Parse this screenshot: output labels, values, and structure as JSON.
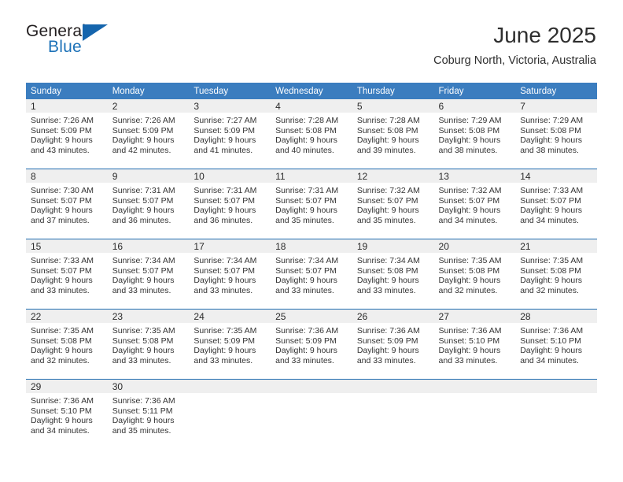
{
  "brand": {
    "word1": "General",
    "word2": "Blue",
    "triangle_color": "#1565ad"
  },
  "header": {
    "title": "June 2025",
    "subtitle": "Coburg North, Victoria, Australia"
  },
  "theme": {
    "header_blue": "#3b7dbf",
    "rule_blue": "#1f6cb0",
    "daynum_band": "#efefef"
  },
  "weekday_headers": [
    "Sunday",
    "Monday",
    "Tuesday",
    "Wednesday",
    "Thursday",
    "Friday",
    "Saturday"
  ],
  "labels": {
    "sunrise_prefix": "Sunrise:",
    "sunset_prefix": "Sunset:",
    "daylight_prefix": "Daylight:"
  },
  "weeks": [
    [
      {
        "day": "1",
        "sunrise": "Sunrise: 7:26 AM",
        "sunset": "Sunset: 5:09 PM",
        "daylight_l1": "Daylight: 9 hours",
        "daylight_l2": "and 43 minutes."
      },
      {
        "day": "2",
        "sunrise": "Sunrise: 7:26 AM",
        "sunset": "Sunset: 5:09 PM",
        "daylight_l1": "Daylight: 9 hours",
        "daylight_l2": "and 42 minutes."
      },
      {
        "day": "3",
        "sunrise": "Sunrise: 7:27 AM",
        "sunset": "Sunset: 5:09 PM",
        "daylight_l1": "Daylight: 9 hours",
        "daylight_l2": "and 41 minutes."
      },
      {
        "day": "4",
        "sunrise": "Sunrise: 7:28 AM",
        "sunset": "Sunset: 5:08 PM",
        "daylight_l1": "Daylight: 9 hours",
        "daylight_l2": "and 40 minutes."
      },
      {
        "day": "5",
        "sunrise": "Sunrise: 7:28 AM",
        "sunset": "Sunset: 5:08 PM",
        "daylight_l1": "Daylight: 9 hours",
        "daylight_l2": "and 39 minutes."
      },
      {
        "day": "6",
        "sunrise": "Sunrise: 7:29 AM",
        "sunset": "Sunset: 5:08 PM",
        "daylight_l1": "Daylight: 9 hours",
        "daylight_l2": "and 38 minutes."
      },
      {
        "day": "7",
        "sunrise": "Sunrise: 7:29 AM",
        "sunset": "Sunset: 5:08 PM",
        "daylight_l1": "Daylight: 9 hours",
        "daylight_l2": "and 38 minutes."
      }
    ],
    [
      {
        "day": "8",
        "sunrise": "Sunrise: 7:30 AM",
        "sunset": "Sunset: 5:07 PM",
        "daylight_l1": "Daylight: 9 hours",
        "daylight_l2": "and 37 minutes."
      },
      {
        "day": "9",
        "sunrise": "Sunrise: 7:31 AM",
        "sunset": "Sunset: 5:07 PM",
        "daylight_l1": "Daylight: 9 hours",
        "daylight_l2": "and 36 minutes."
      },
      {
        "day": "10",
        "sunrise": "Sunrise: 7:31 AM",
        "sunset": "Sunset: 5:07 PM",
        "daylight_l1": "Daylight: 9 hours",
        "daylight_l2": "and 36 minutes."
      },
      {
        "day": "11",
        "sunrise": "Sunrise: 7:31 AM",
        "sunset": "Sunset: 5:07 PM",
        "daylight_l1": "Daylight: 9 hours",
        "daylight_l2": "and 35 minutes."
      },
      {
        "day": "12",
        "sunrise": "Sunrise: 7:32 AM",
        "sunset": "Sunset: 5:07 PM",
        "daylight_l1": "Daylight: 9 hours",
        "daylight_l2": "and 35 minutes."
      },
      {
        "day": "13",
        "sunrise": "Sunrise: 7:32 AM",
        "sunset": "Sunset: 5:07 PM",
        "daylight_l1": "Daylight: 9 hours",
        "daylight_l2": "and 34 minutes."
      },
      {
        "day": "14",
        "sunrise": "Sunrise: 7:33 AM",
        "sunset": "Sunset: 5:07 PM",
        "daylight_l1": "Daylight: 9 hours",
        "daylight_l2": "and 34 minutes."
      }
    ],
    [
      {
        "day": "15",
        "sunrise": "Sunrise: 7:33 AM",
        "sunset": "Sunset: 5:07 PM",
        "daylight_l1": "Daylight: 9 hours",
        "daylight_l2": "and 33 minutes."
      },
      {
        "day": "16",
        "sunrise": "Sunrise: 7:34 AM",
        "sunset": "Sunset: 5:07 PM",
        "daylight_l1": "Daylight: 9 hours",
        "daylight_l2": "and 33 minutes."
      },
      {
        "day": "17",
        "sunrise": "Sunrise: 7:34 AM",
        "sunset": "Sunset: 5:07 PM",
        "daylight_l1": "Daylight: 9 hours",
        "daylight_l2": "and 33 minutes."
      },
      {
        "day": "18",
        "sunrise": "Sunrise: 7:34 AM",
        "sunset": "Sunset: 5:07 PM",
        "daylight_l1": "Daylight: 9 hours",
        "daylight_l2": "and 33 minutes."
      },
      {
        "day": "19",
        "sunrise": "Sunrise: 7:34 AM",
        "sunset": "Sunset: 5:08 PM",
        "daylight_l1": "Daylight: 9 hours",
        "daylight_l2": "and 33 minutes."
      },
      {
        "day": "20",
        "sunrise": "Sunrise: 7:35 AM",
        "sunset": "Sunset: 5:08 PM",
        "daylight_l1": "Daylight: 9 hours",
        "daylight_l2": "and 32 minutes."
      },
      {
        "day": "21",
        "sunrise": "Sunrise: 7:35 AM",
        "sunset": "Sunset: 5:08 PM",
        "daylight_l1": "Daylight: 9 hours",
        "daylight_l2": "and 32 minutes."
      }
    ],
    [
      {
        "day": "22",
        "sunrise": "Sunrise: 7:35 AM",
        "sunset": "Sunset: 5:08 PM",
        "daylight_l1": "Daylight: 9 hours",
        "daylight_l2": "and 32 minutes."
      },
      {
        "day": "23",
        "sunrise": "Sunrise: 7:35 AM",
        "sunset": "Sunset: 5:08 PM",
        "daylight_l1": "Daylight: 9 hours",
        "daylight_l2": "and 33 minutes."
      },
      {
        "day": "24",
        "sunrise": "Sunrise: 7:35 AM",
        "sunset": "Sunset: 5:09 PM",
        "daylight_l1": "Daylight: 9 hours",
        "daylight_l2": "and 33 minutes."
      },
      {
        "day": "25",
        "sunrise": "Sunrise: 7:36 AM",
        "sunset": "Sunset: 5:09 PM",
        "daylight_l1": "Daylight: 9 hours",
        "daylight_l2": "and 33 minutes."
      },
      {
        "day": "26",
        "sunrise": "Sunrise: 7:36 AM",
        "sunset": "Sunset: 5:09 PM",
        "daylight_l1": "Daylight: 9 hours",
        "daylight_l2": "and 33 minutes."
      },
      {
        "day": "27",
        "sunrise": "Sunrise: 7:36 AM",
        "sunset": "Sunset: 5:10 PM",
        "daylight_l1": "Daylight: 9 hours",
        "daylight_l2": "and 33 minutes."
      },
      {
        "day": "28",
        "sunrise": "Sunrise: 7:36 AM",
        "sunset": "Sunset: 5:10 PM",
        "daylight_l1": "Daylight: 9 hours",
        "daylight_l2": "and 34 minutes."
      }
    ],
    [
      {
        "day": "29",
        "sunrise": "Sunrise: 7:36 AM",
        "sunset": "Sunset: 5:10 PM",
        "daylight_l1": "Daylight: 9 hours",
        "daylight_l2": "and 34 minutes."
      },
      {
        "day": "30",
        "sunrise": "Sunrise: 7:36 AM",
        "sunset": "Sunset: 5:11 PM",
        "daylight_l1": "Daylight: 9 hours",
        "daylight_l2": "and 35 minutes."
      },
      {
        "day": "",
        "sunrise": "",
        "sunset": "",
        "daylight_l1": "",
        "daylight_l2": ""
      },
      {
        "day": "",
        "sunrise": "",
        "sunset": "",
        "daylight_l1": "",
        "daylight_l2": ""
      },
      {
        "day": "",
        "sunrise": "",
        "sunset": "",
        "daylight_l1": "",
        "daylight_l2": ""
      },
      {
        "day": "",
        "sunrise": "",
        "sunset": "",
        "daylight_l1": "",
        "daylight_l2": ""
      },
      {
        "day": "",
        "sunrise": "",
        "sunset": "",
        "daylight_l1": "",
        "daylight_l2": ""
      }
    ]
  ]
}
